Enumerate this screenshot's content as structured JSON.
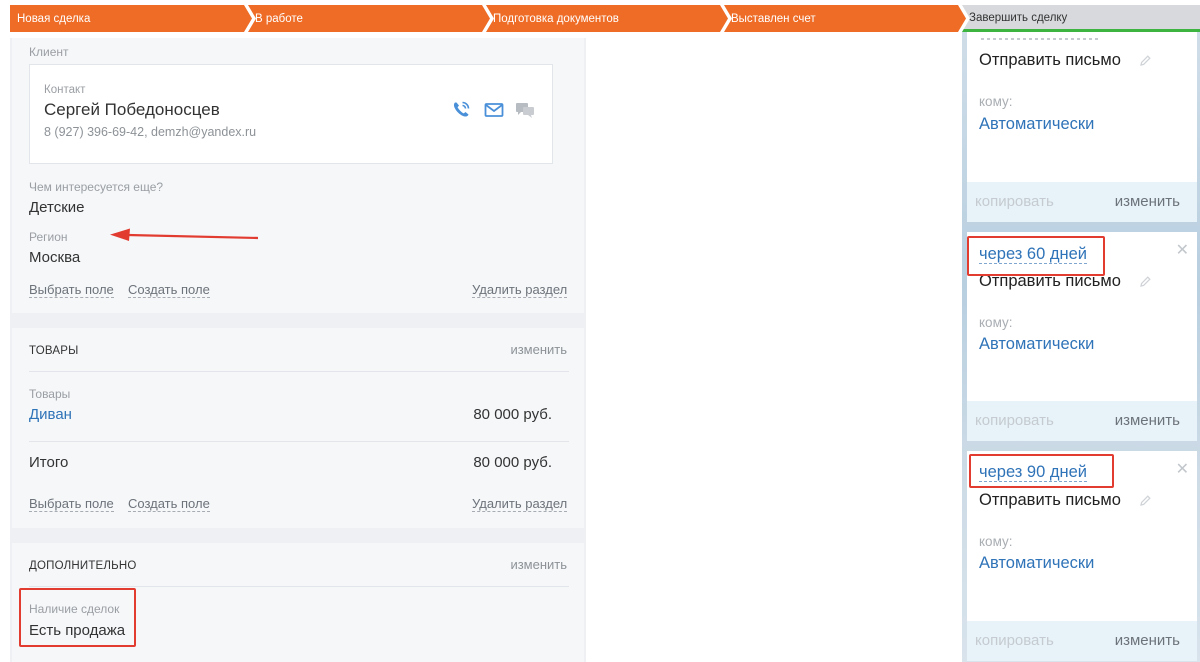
{
  "stages": [
    "Новая сделка",
    "В работе",
    "Подготовка документов",
    "Выставлен счет",
    "Завершить сделку"
  ],
  "client": {
    "section_label": "Клиент",
    "contact_label": "Контакт",
    "contact_name": "Сергей Победоносцев",
    "contact_info": "8 (927) 396-69-42, demzh@yandex.ru",
    "interest_label": "Чем интересуется еще?",
    "interest_value": "Детские",
    "region_label": "Регион",
    "region_value": "Москва",
    "choose_field": "Выбрать поле",
    "create_field": "Создать поле",
    "delete_section": "Удалить раздел"
  },
  "goods": {
    "title": "ТОВАРЫ",
    "edit": "изменить",
    "label": "Товары",
    "item_name": "Диван",
    "item_price": "80 000 руб.",
    "total_label": "Итого",
    "total_value": "80 000 руб.",
    "choose_field": "Выбрать поле",
    "create_field": "Создать поле",
    "delete_section": "Удалить раздел"
  },
  "extra": {
    "title": "ДОПОЛНИТЕЛЬНО",
    "edit": "изменить",
    "deals_label": "Наличие сделок",
    "deals_value": "Есть продажа"
  },
  "tasks": [
    {
      "due": "",
      "action": "Отправить письмо",
      "to_label": "кому:",
      "to_value": "Автоматически",
      "copy": "копировать",
      "change": "изменить"
    },
    {
      "due": "через 60 дней",
      "action": "Отправить письмо",
      "to_label": "кому:",
      "to_value": "Автоматически",
      "copy": "копировать",
      "change": "изменить"
    },
    {
      "due": "через 90 дней",
      "action": "Отправить письмо",
      "to_label": "кому:",
      "to_value": "Автоматически",
      "copy": "копировать",
      "change": "изменить"
    }
  ],
  "colors": {
    "stage_active": "#ee6c26",
    "stage_final": "#d7d9dc",
    "link_blue": "#2f73b8",
    "annotation_red": "#e23b30"
  },
  "icons": [
    "phone-icon",
    "mail-icon",
    "chat-icon",
    "pencil-icon",
    "close-icon",
    "arrow-annotation"
  ]
}
